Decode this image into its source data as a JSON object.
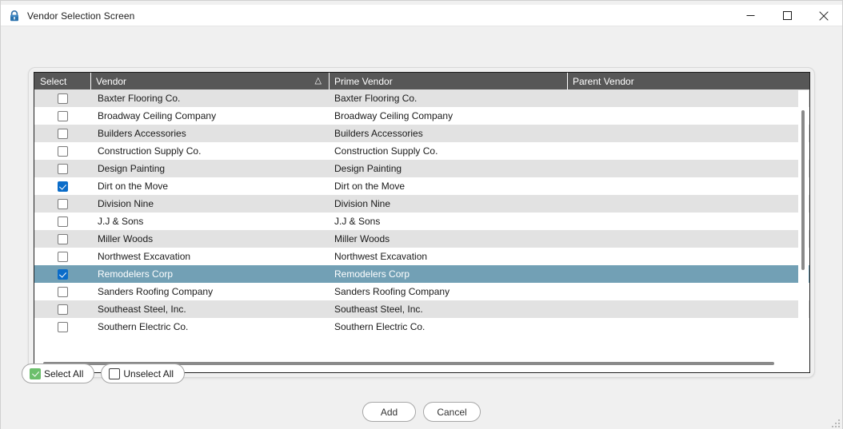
{
  "window": {
    "title": "Vendor Selection Screen",
    "icon": "lock-icon",
    "controls": {
      "minimize": "minimize-icon",
      "maximize": "maximize-icon",
      "close": "close-icon"
    }
  },
  "colors": {
    "header_bg": "#575757",
    "header_text": "#ffffff",
    "row_alt_bg": "#e2e2e2",
    "row_bg": "#ffffff",
    "selected_row_bg": "#72a0b5",
    "checkbox_checked": "#0a6cc9",
    "select_all_icon": "#6cbf6c",
    "dialog_bg": "#f0f0f0",
    "scroll_thumb": "#8a8a8a"
  },
  "grid": {
    "columns": [
      {
        "key": "select",
        "label": "Select",
        "sorted": false
      },
      {
        "key": "vendor",
        "label": "Vendor",
        "sorted": true,
        "sort_indicator": "△"
      },
      {
        "key": "prime_vendor",
        "label": "Prime Vendor",
        "sorted": false
      },
      {
        "key": "parent_vendor",
        "label": "Parent Vendor",
        "sorted": false
      }
    ],
    "rows": [
      {
        "checked": false,
        "selected": false,
        "vendor": "Baxter Flooring Co.",
        "prime_vendor": "Baxter Flooring Co.",
        "parent_vendor": ""
      },
      {
        "checked": false,
        "selected": false,
        "vendor": "Broadway Ceiling Company",
        "prime_vendor": "Broadway Ceiling Company",
        "parent_vendor": ""
      },
      {
        "checked": false,
        "selected": false,
        "vendor": "Builders Accessories",
        "prime_vendor": "Builders Accessories",
        "parent_vendor": ""
      },
      {
        "checked": false,
        "selected": false,
        "vendor": "Construction Supply Co.",
        "prime_vendor": "Construction Supply Co.",
        "parent_vendor": ""
      },
      {
        "checked": false,
        "selected": false,
        "vendor": "Design Painting",
        "prime_vendor": "Design Painting",
        "parent_vendor": ""
      },
      {
        "checked": true,
        "selected": false,
        "vendor": "Dirt on the Move",
        "prime_vendor": "Dirt on the Move",
        "parent_vendor": ""
      },
      {
        "checked": false,
        "selected": false,
        "vendor": "Division Nine",
        "prime_vendor": "Division Nine",
        "parent_vendor": ""
      },
      {
        "checked": false,
        "selected": false,
        "vendor": "J.J & Sons",
        "prime_vendor": "J.J & Sons",
        "parent_vendor": ""
      },
      {
        "checked": false,
        "selected": false,
        "vendor": "Miller Woods",
        "prime_vendor": "Miller Woods",
        "parent_vendor": ""
      },
      {
        "checked": false,
        "selected": false,
        "vendor": "Northwest Excavation",
        "prime_vendor": "Northwest Excavation",
        "parent_vendor": ""
      },
      {
        "checked": true,
        "selected": true,
        "vendor": "Remodelers Corp",
        "prime_vendor": "Remodelers Corp",
        "parent_vendor": ""
      },
      {
        "checked": false,
        "selected": false,
        "vendor": "Sanders Roofing Company",
        "prime_vendor": "Sanders Roofing Company",
        "parent_vendor": ""
      },
      {
        "checked": false,
        "selected": false,
        "vendor": "Southeast Steel, Inc.",
        "prime_vendor": "Southeast Steel, Inc.",
        "parent_vendor": ""
      },
      {
        "checked": false,
        "selected": false,
        "vendor": "Southern Electric Co.",
        "prime_vendor": "Southern Electric Co.",
        "parent_vendor": ""
      }
    ]
  },
  "toolbar": {
    "select_all_label": "Select All",
    "unselect_all_label": "Unselect All"
  },
  "actions": {
    "add_label": "Add",
    "cancel_label": "Cancel"
  }
}
